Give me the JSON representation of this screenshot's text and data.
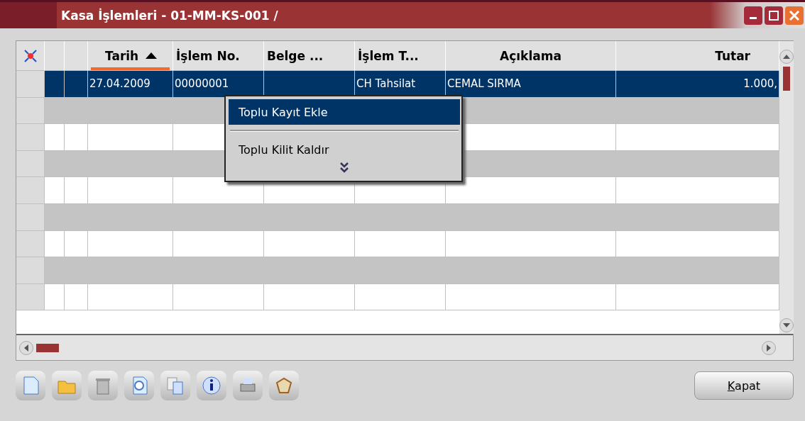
{
  "window": {
    "title": "Kasa İşlemleri - 01-MM-KS-001 /"
  },
  "grid": {
    "columns": [
      {
        "label": "Tarih",
        "sorted": true
      },
      {
        "label": "İşlem No.",
        "sorted": false
      },
      {
        "label": "Belge ...",
        "sorted": false
      },
      {
        "label": "İşlem T...",
        "sorted": false
      },
      {
        "label": "Açıklama",
        "sorted": false
      },
      {
        "label": "Tutar",
        "sorted": false
      }
    ],
    "rows": [
      {
        "selected": true,
        "cells": [
          "27.04.2009",
          "00000001",
          "",
          "CH Tahsilat",
          "CEMAL SIRMA",
          "1.000,"
        ]
      }
    ]
  },
  "context_menu": {
    "items": [
      {
        "kind": "item",
        "label": "Toplu Kayıt Ekle",
        "selected": true
      },
      {
        "kind": "separator"
      },
      {
        "kind": "item",
        "label": "Toplu Kilit Kaldır",
        "selected": false
      }
    ]
  },
  "close_button": {
    "label": "Kapat"
  }
}
